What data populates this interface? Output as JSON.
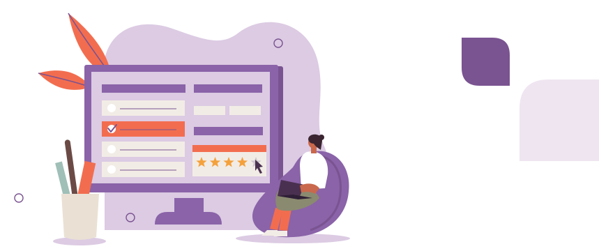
{
  "scene": {
    "kind": "customer-feedback-illustration",
    "rating": {
      "filled_stars": 4,
      "total_stars": 5
    },
    "checklist": {
      "item_count": 4,
      "selected_item": 2
    },
    "colors": {
      "accent_purple": "#8a63a8",
      "deep_purple": "#7a5391",
      "soft_lavender": "#dccbe3",
      "pale_lavender": "#efe5f1",
      "coral": "#f26d4f",
      "star_orange": "#f4a13c",
      "cream": "#f2ece6",
      "pot_beige": "#eae1d4"
    },
    "icons": [
      "monitor",
      "checkbox",
      "star-rating",
      "mouse-cursor",
      "laptop",
      "beanbag-chair",
      "pen-holder",
      "leaf-plant"
    ]
  }
}
